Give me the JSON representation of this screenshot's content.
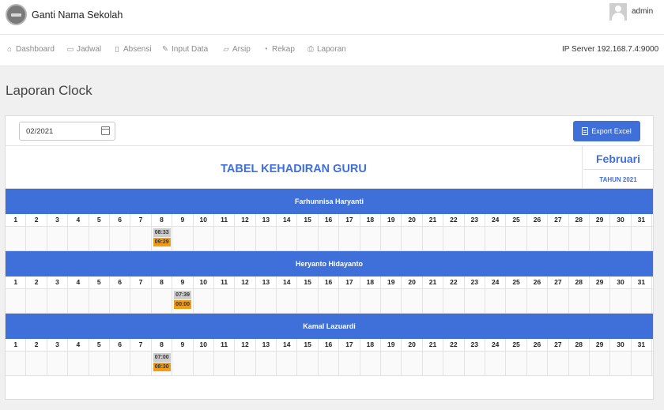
{
  "header": {
    "brand": "Ganti Nama Sekolah",
    "username": "admin"
  },
  "nav": {
    "items": [
      {
        "label": "Dashboard",
        "icon": "home-icon",
        "glyph": "⌂"
      },
      {
        "label": "Jadwal",
        "icon": "calendar-icon",
        "glyph": "▭"
      },
      {
        "label": "Absensi",
        "icon": "clipboard-icon",
        "glyph": "▯"
      },
      {
        "label": "Input Data",
        "icon": "pencil-icon",
        "glyph": "✎"
      },
      {
        "label": "Arsip",
        "icon": "folder-icon",
        "glyph": "▱"
      },
      {
        "label": "Rekap",
        "icon": "chart-pie-icon",
        "glyph": "◔"
      },
      {
        "label": "Laporan",
        "icon": "printer-icon",
        "glyph": "⎙"
      }
    ],
    "ip_server": "IP Server 192.168.7.4:9000"
  },
  "page": {
    "title": "Laporan Clock"
  },
  "filters": {
    "month_value": "02/2021"
  },
  "actions": {
    "export_label": "Export Excel"
  },
  "report": {
    "table_title": "TABEL KEHADIRAN GURU",
    "month": "Februari",
    "year": "TAHUN 2021",
    "days": [
      1,
      2,
      3,
      4,
      5,
      6,
      7,
      8,
      9,
      10,
      11,
      12,
      13,
      14,
      15,
      16,
      17,
      18,
      19,
      20,
      21,
      22,
      23,
      24,
      25,
      26,
      27,
      28,
      29,
      30,
      31
    ],
    "teachers": [
      {
        "name": "Farhunnisa Haryanti",
        "records": [
          {
            "day": 8,
            "in": "08:33",
            "out": "09:29"
          }
        ]
      },
      {
        "name": "Heryanto Hidayanto",
        "records": [
          {
            "day": 9,
            "in": "07:39",
            "out": "00:00"
          }
        ]
      },
      {
        "name": "Kamal Lazuardi",
        "records": [
          {
            "day": 8,
            "in": "07:00",
            "out": "08:30"
          }
        ]
      }
    ]
  },
  "colors": {
    "primary": "#3f6fd8",
    "clock_in": "#cdcdcd",
    "clock_out": "#f39c12"
  }
}
